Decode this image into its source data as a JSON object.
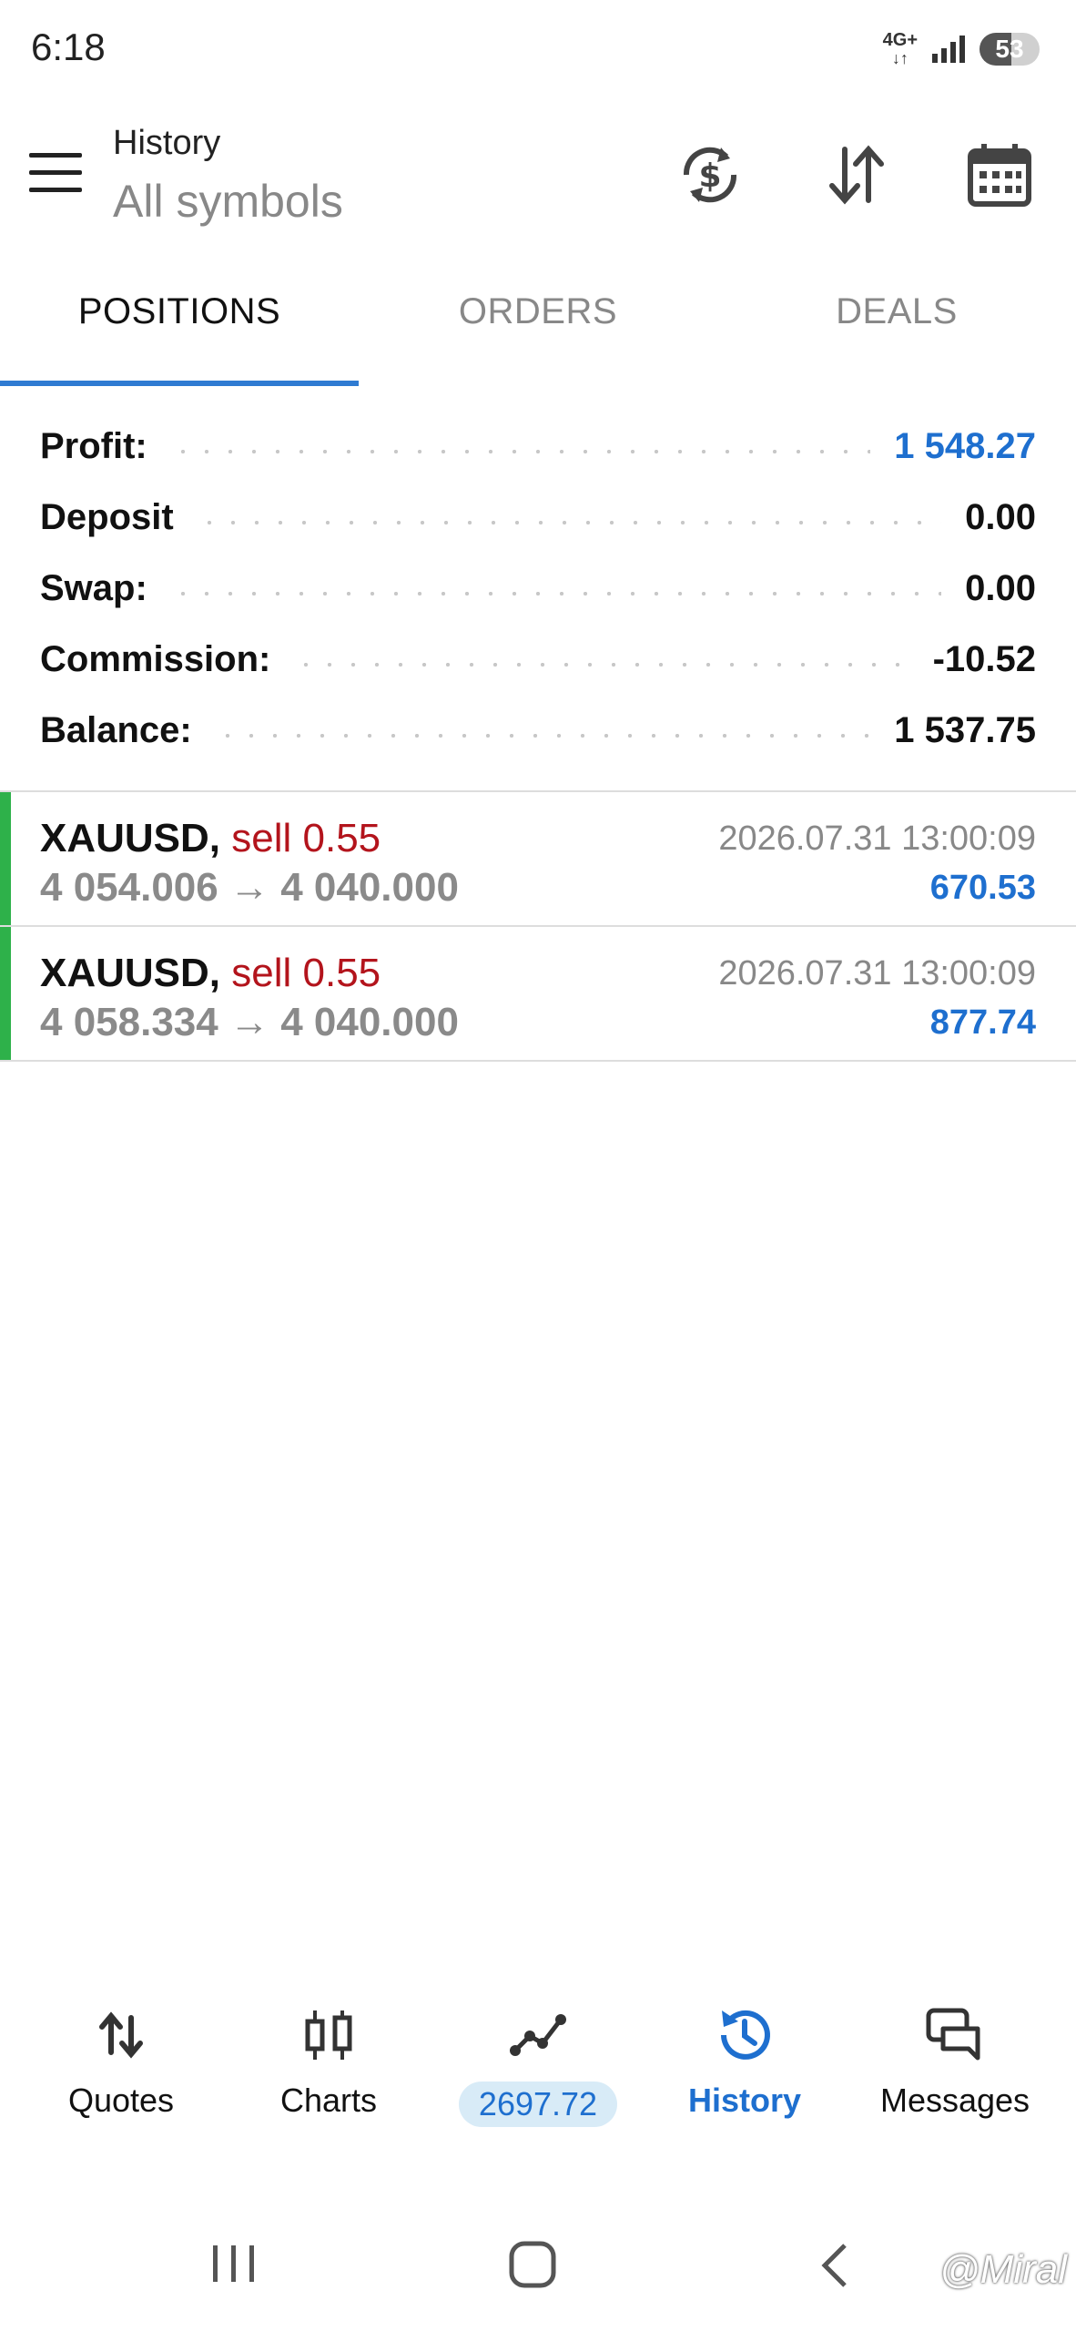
{
  "status_bar": {
    "time": "6:18",
    "network": "4G+",
    "battery": "53"
  },
  "header": {
    "title": "History",
    "subtitle": "All symbols"
  },
  "tabs": [
    {
      "label": "POSITIONS",
      "active": true
    },
    {
      "label": "ORDERS",
      "active": false
    },
    {
      "label": "DEALS",
      "active": false
    }
  ],
  "summary": {
    "profit": {
      "label": "Profit:",
      "value": "1 548.27"
    },
    "deposit": {
      "label": "Deposit",
      "value": "0.00"
    },
    "swap": {
      "label": "Swap:",
      "value": "0.00"
    },
    "commission": {
      "label": "Commission:",
      "value": "-10.52"
    },
    "balance": {
      "label": "Balance:",
      "value": "1 537.75"
    }
  },
  "positions": [
    {
      "symbol": "XAUUSD,",
      "side": "sell 0.55",
      "price": "4 054.006 → 4 040.000",
      "time": "2026.07.31 13:00:09",
      "profit": "670.53"
    },
    {
      "symbol": "XAUUSD,",
      "side": "sell 0.55",
      "price": "4 058.334 → 4 040.000",
      "time": "2026.07.31 13:00:09",
      "profit": "877.74"
    }
  ],
  "bottom_nav": [
    {
      "label": "Quotes",
      "icon": "quotes-icon"
    },
    {
      "label": "Charts",
      "icon": "charts-icon"
    },
    {
      "label": "2697.72",
      "icon": "trade-icon"
    },
    {
      "label": "History",
      "icon": "history-icon",
      "active": true
    },
    {
      "label": "Messages",
      "icon": "messages-icon"
    }
  ],
  "watermark": "@Miral",
  "colors": {
    "accent": "#1e6fcf",
    "sell": "#b3141c",
    "profit_bar": "#2eb14a"
  }
}
